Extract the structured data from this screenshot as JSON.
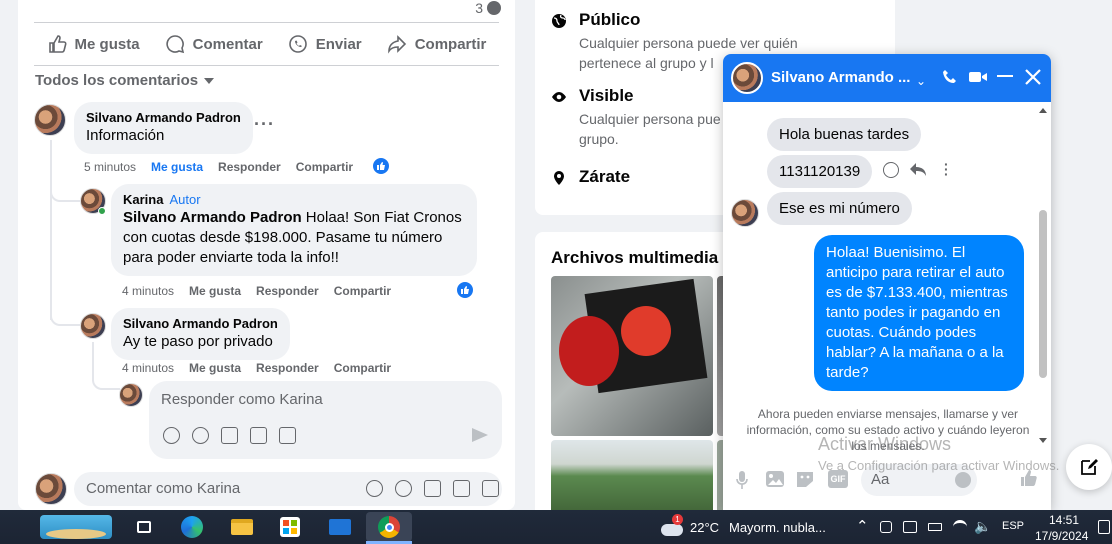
{
  "post": {
    "comment_count": "3",
    "actions": {
      "like": "Me gusta",
      "comment": "Comentar",
      "send": "Enviar",
      "share": "Compartir"
    },
    "filter_label": "Todos los comentarios"
  },
  "comments": [
    {
      "author": "Silvano Armando Padron",
      "text": "Información",
      "time": "5 minutos",
      "like": "Me gusta",
      "reply": "Responder",
      "share": "Compartir"
    },
    {
      "author": "Karina",
      "badge": "Autor",
      "mention": "Silvano Armando Padron",
      "text": " Holaa! Son Fiat Cronos con cuotas desde $198.000. Pasame tu número para poder enviarte toda la info!!",
      "time": "4 minutos",
      "like": "Me gusta",
      "reply": "Responder",
      "share": "Compartir"
    },
    {
      "author": "Silvano Armando Padron",
      "text": "Ay te paso por privado",
      "time": "4 minutos",
      "like": "Me gusta",
      "reply": "Responder",
      "share": "Compartir"
    }
  ],
  "reply_placeholder": "Responder como Karina",
  "comment_placeholder": "Comentar como Karina",
  "group_info": {
    "public_title": "Público",
    "public_desc": "Cualquier persona puede ver quién pertenece al grupo y l",
    "visible_title": "Visible",
    "visible_desc": "Cualquier persona pue grupo.",
    "location": "Zárate"
  },
  "media": {
    "title": "Archivos multimedia re"
  },
  "chat": {
    "contact_name": "Silvano Armando ...",
    "messages": [
      {
        "dir": "in",
        "text": "Hola buenas tardes"
      },
      {
        "dir": "in",
        "text": "1131120139"
      },
      {
        "dir": "in",
        "text": "Ese es mi número"
      },
      {
        "dir": "out",
        "text": "Holaa! Buenisimo.  El anticipo para retirar el auto es de $7.133.400, mientras tanto podes ir pagando en cuotas. Cuándo podes hablar? A la mañana o a la tarde?"
      }
    ],
    "notice": "Ahora pueden enviarse mensajes, llamarse y ver información, como su estado activo y cuándo leyeron los mensajes.",
    "input_placeholder": "Aa"
  },
  "watermark": {
    "line1": "Activar Windows",
    "line2": "Ve a Configuración para activar Windows."
  },
  "taskbar": {
    "weather_temp": "22°C",
    "weather_desc": "Mayorm. nubla...",
    "weather_alert": "1",
    "language": "ESP",
    "time": "14:51",
    "date": "17/9/2024"
  },
  "colors": {
    "accent": "#1877f2",
    "outgoing_bubble": "#0084ff"
  }
}
